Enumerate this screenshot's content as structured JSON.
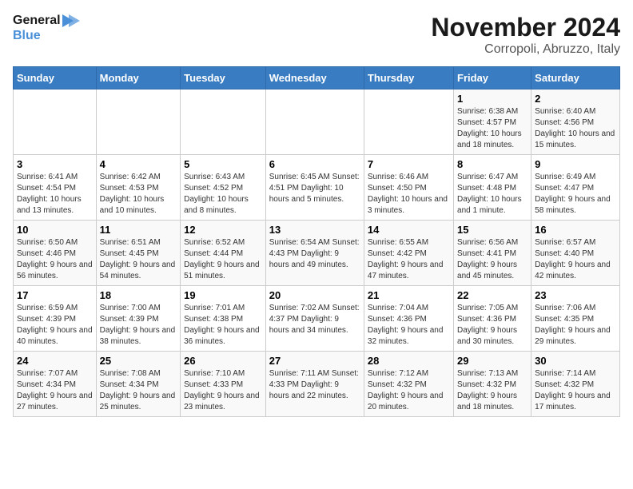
{
  "logo": {
    "line1": "General",
    "line2": "Blue"
  },
  "title": "November 2024",
  "subtitle": "Corropoli, Abruzzo, Italy",
  "days_of_week": [
    "Sunday",
    "Monday",
    "Tuesday",
    "Wednesday",
    "Thursday",
    "Friday",
    "Saturday"
  ],
  "weeks": [
    [
      {
        "day": "",
        "info": ""
      },
      {
        "day": "",
        "info": ""
      },
      {
        "day": "",
        "info": ""
      },
      {
        "day": "",
        "info": ""
      },
      {
        "day": "",
        "info": ""
      },
      {
        "day": "1",
        "info": "Sunrise: 6:38 AM\nSunset: 4:57 PM\nDaylight: 10 hours and 18 minutes."
      },
      {
        "day": "2",
        "info": "Sunrise: 6:40 AM\nSunset: 4:56 PM\nDaylight: 10 hours and 15 minutes."
      }
    ],
    [
      {
        "day": "3",
        "info": "Sunrise: 6:41 AM\nSunset: 4:54 PM\nDaylight: 10 hours and 13 minutes."
      },
      {
        "day": "4",
        "info": "Sunrise: 6:42 AM\nSunset: 4:53 PM\nDaylight: 10 hours and 10 minutes."
      },
      {
        "day": "5",
        "info": "Sunrise: 6:43 AM\nSunset: 4:52 PM\nDaylight: 10 hours and 8 minutes."
      },
      {
        "day": "6",
        "info": "Sunrise: 6:45 AM\nSunset: 4:51 PM\nDaylight: 10 hours and 5 minutes."
      },
      {
        "day": "7",
        "info": "Sunrise: 6:46 AM\nSunset: 4:50 PM\nDaylight: 10 hours and 3 minutes."
      },
      {
        "day": "8",
        "info": "Sunrise: 6:47 AM\nSunset: 4:48 PM\nDaylight: 10 hours and 1 minute."
      },
      {
        "day": "9",
        "info": "Sunrise: 6:49 AM\nSunset: 4:47 PM\nDaylight: 9 hours and 58 minutes."
      }
    ],
    [
      {
        "day": "10",
        "info": "Sunrise: 6:50 AM\nSunset: 4:46 PM\nDaylight: 9 hours and 56 minutes."
      },
      {
        "day": "11",
        "info": "Sunrise: 6:51 AM\nSunset: 4:45 PM\nDaylight: 9 hours and 54 minutes."
      },
      {
        "day": "12",
        "info": "Sunrise: 6:52 AM\nSunset: 4:44 PM\nDaylight: 9 hours and 51 minutes."
      },
      {
        "day": "13",
        "info": "Sunrise: 6:54 AM\nSunset: 4:43 PM\nDaylight: 9 hours and 49 minutes."
      },
      {
        "day": "14",
        "info": "Sunrise: 6:55 AM\nSunset: 4:42 PM\nDaylight: 9 hours and 47 minutes."
      },
      {
        "day": "15",
        "info": "Sunrise: 6:56 AM\nSunset: 4:41 PM\nDaylight: 9 hours and 45 minutes."
      },
      {
        "day": "16",
        "info": "Sunrise: 6:57 AM\nSunset: 4:40 PM\nDaylight: 9 hours and 42 minutes."
      }
    ],
    [
      {
        "day": "17",
        "info": "Sunrise: 6:59 AM\nSunset: 4:39 PM\nDaylight: 9 hours and 40 minutes."
      },
      {
        "day": "18",
        "info": "Sunrise: 7:00 AM\nSunset: 4:39 PM\nDaylight: 9 hours and 38 minutes."
      },
      {
        "day": "19",
        "info": "Sunrise: 7:01 AM\nSunset: 4:38 PM\nDaylight: 9 hours and 36 minutes."
      },
      {
        "day": "20",
        "info": "Sunrise: 7:02 AM\nSunset: 4:37 PM\nDaylight: 9 hours and 34 minutes."
      },
      {
        "day": "21",
        "info": "Sunrise: 7:04 AM\nSunset: 4:36 PM\nDaylight: 9 hours and 32 minutes."
      },
      {
        "day": "22",
        "info": "Sunrise: 7:05 AM\nSunset: 4:36 PM\nDaylight: 9 hours and 30 minutes."
      },
      {
        "day": "23",
        "info": "Sunrise: 7:06 AM\nSunset: 4:35 PM\nDaylight: 9 hours and 29 minutes."
      }
    ],
    [
      {
        "day": "24",
        "info": "Sunrise: 7:07 AM\nSunset: 4:34 PM\nDaylight: 9 hours and 27 minutes."
      },
      {
        "day": "25",
        "info": "Sunrise: 7:08 AM\nSunset: 4:34 PM\nDaylight: 9 hours and 25 minutes."
      },
      {
        "day": "26",
        "info": "Sunrise: 7:10 AM\nSunset: 4:33 PM\nDaylight: 9 hours and 23 minutes."
      },
      {
        "day": "27",
        "info": "Sunrise: 7:11 AM\nSunset: 4:33 PM\nDaylight: 9 hours and 22 minutes."
      },
      {
        "day": "28",
        "info": "Sunrise: 7:12 AM\nSunset: 4:32 PM\nDaylight: 9 hours and 20 minutes."
      },
      {
        "day": "29",
        "info": "Sunrise: 7:13 AM\nSunset: 4:32 PM\nDaylight: 9 hours and 18 minutes."
      },
      {
        "day": "30",
        "info": "Sunrise: 7:14 AM\nSunset: 4:32 PM\nDaylight: 9 hours and 17 minutes."
      }
    ]
  ]
}
